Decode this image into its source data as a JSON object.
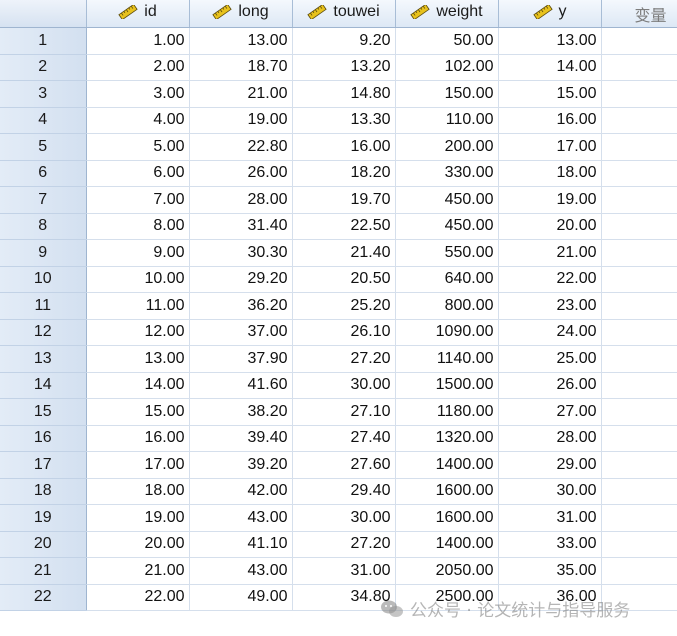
{
  "columns": [
    {
      "name": "id",
      "icon": "ruler-scale-icon"
    },
    {
      "name": "long",
      "icon": "ruler-scale-icon"
    },
    {
      "name": "touwei",
      "icon": "ruler-scale-icon"
    },
    {
      "name": "weight",
      "icon": "ruler-scale-icon"
    },
    {
      "name": "y",
      "icon": "ruler-scale-icon"
    }
  ],
  "placeholder_column_label": "变量",
  "rows": [
    {
      "num": "1",
      "id": "1.00",
      "long": "13.00",
      "touwei": "9.20",
      "weight": "50.00",
      "y": "13.00"
    },
    {
      "num": "2",
      "id": "2.00",
      "long": "18.70",
      "touwei": "13.20",
      "weight": "102.00",
      "y": "14.00"
    },
    {
      "num": "3",
      "id": "3.00",
      "long": "21.00",
      "touwei": "14.80",
      "weight": "150.00",
      "y": "15.00"
    },
    {
      "num": "4",
      "id": "4.00",
      "long": "19.00",
      "touwei": "13.30",
      "weight": "110.00",
      "y": "16.00"
    },
    {
      "num": "5",
      "id": "5.00",
      "long": "22.80",
      "touwei": "16.00",
      "weight": "200.00",
      "y": "17.00"
    },
    {
      "num": "6",
      "id": "6.00",
      "long": "26.00",
      "touwei": "18.20",
      "weight": "330.00",
      "y": "18.00"
    },
    {
      "num": "7",
      "id": "7.00",
      "long": "28.00",
      "touwei": "19.70",
      "weight": "450.00",
      "y": "19.00"
    },
    {
      "num": "8",
      "id": "8.00",
      "long": "31.40",
      "touwei": "22.50",
      "weight": "450.00",
      "y": "20.00"
    },
    {
      "num": "9",
      "id": "9.00",
      "long": "30.30",
      "touwei": "21.40",
      "weight": "550.00",
      "y": "21.00"
    },
    {
      "num": "10",
      "id": "10.00",
      "long": "29.20",
      "touwei": "20.50",
      "weight": "640.00",
      "y": "22.00"
    },
    {
      "num": "11",
      "id": "11.00",
      "long": "36.20",
      "touwei": "25.20",
      "weight": "800.00",
      "y": "23.00"
    },
    {
      "num": "12",
      "id": "12.00",
      "long": "37.00",
      "touwei": "26.10",
      "weight": "1090.00",
      "y": "24.00"
    },
    {
      "num": "13",
      "id": "13.00",
      "long": "37.90",
      "touwei": "27.20",
      "weight": "1140.00",
      "y": "25.00"
    },
    {
      "num": "14",
      "id": "14.00",
      "long": "41.60",
      "touwei": "30.00",
      "weight": "1500.00",
      "y": "26.00"
    },
    {
      "num": "15",
      "id": "15.00",
      "long": "38.20",
      "touwei": "27.10",
      "weight": "1180.00",
      "y": "27.00"
    },
    {
      "num": "16",
      "id": "16.00",
      "long": "39.40",
      "touwei": "27.40",
      "weight": "1320.00",
      "y": "28.00"
    },
    {
      "num": "17",
      "id": "17.00",
      "long": "39.20",
      "touwei": "27.60",
      "weight": "1400.00",
      "y": "29.00"
    },
    {
      "num": "18",
      "id": "18.00",
      "long": "42.00",
      "touwei": "29.40",
      "weight": "1600.00",
      "y": "30.00"
    },
    {
      "num": "19",
      "id": "19.00",
      "long": "43.00",
      "touwei": "30.00",
      "weight": "1600.00",
      "y": "31.00"
    },
    {
      "num": "20",
      "id": "20.00",
      "long": "41.10",
      "touwei": "27.20",
      "weight": "1400.00",
      "y": "33.00"
    },
    {
      "num": "21",
      "id": "21.00",
      "long": "43.00",
      "touwei": "31.00",
      "weight": "2050.00",
      "y": "35.00"
    },
    {
      "num": "22",
      "id": "22.00",
      "long": "49.00",
      "touwei": "34.80",
      "weight": "2500.00",
      "y": "36.00"
    }
  ],
  "watermark": {
    "icon": "wechat-icon",
    "text": "公众号 · 论文统计与指导服务"
  },
  "colors": {
    "header_bg": "#dde8f5",
    "rownum_bg": "#d3e0f0",
    "grid_line": "#d5dfec",
    "ruler_yellow": "#e8c21c"
  }
}
